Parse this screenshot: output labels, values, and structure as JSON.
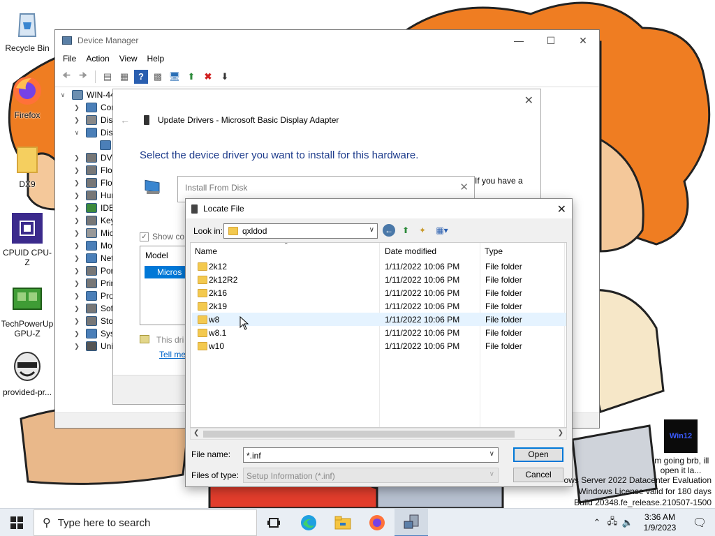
{
  "desktop": {
    "icons": [
      {
        "label": "Recycle Bin",
        "icon": "recycle-bin-icon"
      },
      {
        "label": "Firefox",
        "icon": "firefox-icon"
      },
      {
        "label": "DX9",
        "icon": "folder-icon"
      },
      {
        "label": "CPUID CPU-Z",
        "icon": "cpuz-icon"
      },
      {
        "label": "TechPowerUp GPU-Z",
        "icon": "gpuz-icon"
      },
      {
        "label": "provided-pr...",
        "icon": "hacker-mask-icon"
      }
    ],
    "widget": {
      "tile_text": "Win12",
      "caption": "im going brb, ill open it la..."
    },
    "watermark": {
      "line1": "ows Server 2022 Datacenter Evaluation",
      "line2": "Windows License valid for 180 days",
      "line3": "Build 20348.fe_release.210507-1500"
    }
  },
  "device_manager": {
    "title": "Device Manager",
    "menu": [
      "File",
      "Action",
      "View",
      "Help"
    ],
    "tree": {
      "root": "WIN-44",
      "items": [
        "Cor",
        "Disk",
        "Disp",
        "",
        "DVD",
        "Flop",
        "Flop",
        "Hun",
        "IDE",
        "Key",
        "Mic",
        "Mo",
        "Net",
        "Por",
        "Prir",
        "Pro",
        "Soft",
        "Stor",
        "Syst",
        "Unii"
      ]
    }
  },
  "update_drivers": {
    "header": "Update Drivers - Microsoft Basic Display Adapter",
    "heading": "Select the device driver you want to install for this hardware.",
    "side_text_1": "If you have a",
    "side_text_2": "a",
    "show_compatible": "Show co",
    "model_header": "Model",
    "model_selected": "Micros",
    "signed_text": "This dri",
    "tell_me": "Tell me"
  },
  "install_from_disk": {
    "title": "Install From Disk"
  },
  "locate_file": {
    "title": "Locate File",
    "look_in_label": "Look in:",
    "look_in_value": "qxldod",
    "columns": {
      "name": "Name",
      "date": "Date modified",
      "type": "Type"
    },
    "files": [
      {
        "name": "2k12",
        "date": "1/11/2022 10:06 PM",
        "type": "File folder"
      },
      {
        "name": "2k12R2",
        "date": "1/11/2022 10:06 PM",
        "type": "File folder"
      },
      {
        "name": "2k16",
        "date": "1/11/2022 10:06 PM",
        "type": "File folder"
      },
      {
        "name": "2k19",
        "date": "1/11/2022 10:06 PM",
        "type": "File folder"
      },
      {
        "name": "w8",
        "date": "1/11/2022 10:06 PM",
        "type": "File folder"
      },
      {
        "name": "w8.1",
        "date": "1/11/2022 10:06 PM",
        "type": "File folder"
      },
      {
        "name": "w10",
        "date": "1/11/2022 10:06 PM",
        "type": "File folder"
      }
    ],
    "hovered_row": "w8",
    "file_name_label": "File name:",
    "file_name_value": "*.inf",
    "file_type_label": "Files of type:",
    "file_type_value": "Setup Information (*.inf)",
    "open_label": "Open",
    "cancel_label": "Cancel"
  },
  "taskbar": {
    "search_placeholder": "Type here to search",
    "apps": [
      "task-view-icon",
      "edge-icon",
      "file-explorer-icon",
      "firefox-icon",
      "device-manager-icon"
    ],
    "clock_time": "3:36 AM",
    "clock_date": "1/9/2023"
  },
  "colors": {
    "accent": "#0078d7",
    "heading": "#1e3c8c",
    "link": "#0066cc",
    "hover_row": "#e5f3ff"
  }
}
